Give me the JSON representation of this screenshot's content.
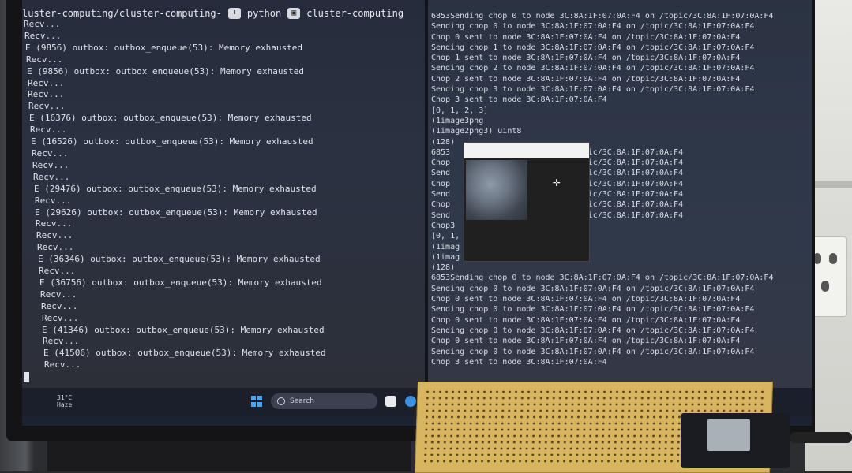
{
  "terminal_left": {
    "tab_path": "luster-computing/cluster-computing-",
    "tab_python": "python",
    "tab_project": "cluster-computing",
    "lines": [
      "Recv...",
      "Recv...",
      "E (9856) outbox: outbox_enqueue(53): Memory exhausted",
      "Recv...",
      "E (9856) outbox: outbox_enqueue(53): Memory exhausted",
      "Recv...",
      "Recv...",
      "Recv...",
      "E (16376) outbox: outbox_enqueue(53): Memory exhausted",
      "Recv...",
      "E (16526) outbox: outbox_enqueue(53): Memory exhausted",
      "Recv...",
      "Recv...",
      "Recv...",
      "E (29476) outbox: outbox_enqueue(53): Memory exhausted",
      "Recv...",
      "E (29626) outbox: outbox_enqueue(53): Memory exhausted",
      "Recv...",
      "Recv...",
      "Recv...",
      "E (36346) outbox: outbox_enqueue(53): Memory exhausted",
      "Recv...",
      "E (36756) outbox: outbox_enqueue(53): Memory exhausted",
      "Recv...",
      "Recv...",
      "Recv...",
      "E (41346) outbox: outbox_enqueue(53): Memory exhausted",
      "Recv...",
      "E (41506) outbox: outbox_enqueue(53): Memory exhausted",
      "Recv..."
    ]
  },
  "terminal_right": {
    "lines": [
      "6853Sending chop 0 to node 3C:8A:1F:07:0A:F4 on /topic/3C:8A:1F:07:0A:F4",
      "Sending chop 0 to node 3C:8A:1F:07:0A:F4 on /topic/3C:8A:1F:07:0A:F4",
      "Chop 0 sent to node 3C:8A:1F:07:0A:F4 on /topic/3C:8A:1F:07:0A:F4",
      "Sending chop 1 to node 3C:8A:1F:07:0A:F4 on /topic/3C:8A:1F:07:0A:F4",
      "Chop 1 sent to node 3C:8A:1F:07:0A:F4 on /topic/3C:8A:1F:07:0A:F4",
      "Sending chop 2 to node 3C:8A:1F:07:0A:F4 on /topic/3C:8A:1F:07:0A:F4",
      "Chop 2 sent to node 3C:8A:1F:07:0A:F4 on /topic/3C:8A:1F:07:0A:F4",
      "Sending chop 3 to node 3C:8A:1F:07:0A:F4 on /topic/3C:8A:1F:07:0A:F4",
      "Chop 3 sent to node 3C:8A:1F:07:0A:F4",
      "[0, 1, 2, 3]",
      "(1image3png",
      "(1image2png3) uint8",
      "(128)",
      "6853            :07:0A:F4 on /topic/3C:8A:1F:07:0A:F4",
      "Chop            :07:0A:F4 on /topic/3C:8A:1F:07:0A:F4",
      "Send            :07:0A:F4 on /topic/3C:8A:1F:07:0A:F4",
      "Chop            :07:0A:F4 on /topic/3C:8A:1F:07:0A:F4",
      "Send            :07:0A:F4 on /topic/3C:8A:1F:07:0A:F4",
      "Chop            :07:0A:F4 on /topic/3C:8A:1F:07:0A:F4",
      "Send            :07:0A:F4 on /topic/3C:8A:1F:07:0A:F4",
      "Chop3           :07:0A:F4",
      "[0, 1,",
      "(1imag",
      "(1imag",
      "(128)",
      "6853Sending chop 0 to node 3C:8A:1F:07:0A:F4 on /topic/3C:8A:1F:07:0A:F4",
      "Sending chop 0 to node 3C:8A:1F:07:0A:F4 on /topic/3C:8A:1F:07:0A:F4",
      "Chop 0 sent to node 3C:8A:1F:07:0A:F4 on /topic/3C:8A:1F:07:0A:F4",
      "Sending chop 0 to node 3C:8A:1F:07:0A:F4 on /topic/3C:8A:1F:07:0A:F4",
      "Chop 0 sent to node 3C:8A:1F:07:0A:F4 on /topic/3C:8A:1F:07:0A:F4",
      "Sending chop 0 to node 3C:8A:1F:07:0A:F4 on /topic/3C:8A:1F:07:0A:F4",
      "Chop 0 sent to node 3C:8A:1F:07:0A:F4 on /topic/3C:8A:1F:07:0A:F4",
      "Sending chop 0 to node 3C:8A:1F:07:0A:F4 on /topic/3C:8A:1F:07:0A:F4",
      "Chop 3 sent to node 3C:8A:1F:07:0A:F4"
    ]
  },
  "taskbar": {
    "temperature": "31°C",
    "weather": "Haze",
    "search_label": "Search"
  },
  "colors": {
    "terminal_bg": "#2a3242",
    "terminal_text": "#dfe3ea",
    "taskbar_bg": "#1a1f2b",
    "breadboard": "#d8b560"
  }
}
